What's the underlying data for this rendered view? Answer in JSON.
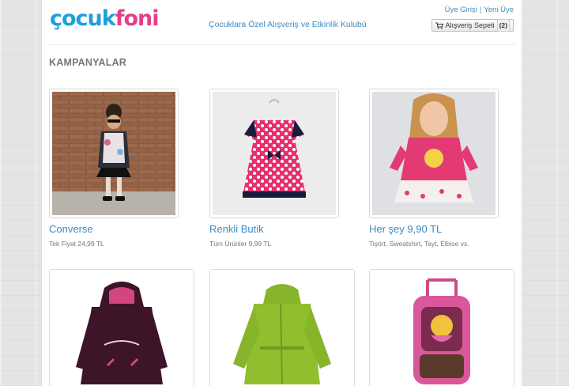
{
  "brand": {
    "logo_part1": "çocuk",
    "logo_part2": "foni",
    "tagline": "Çocuklara Özel Alışveriş ve Etkinlik Kulubü"
  },
  "user_links": {
    "login": "Üye Girişi",
    "separator": "|",
    "register": "Yeni Üye"
  },
  "cart": {
    "label": "Alışveriş Sepeti",
    "count": "2"
  },
  "section_title": "KAMPANYALAR",
  "campaigns": [
    {
      "title": "Converse",
      "subtitle": "Tek Fiyat 24,99 TL"
    },
    {
      "title": "Renkli Butik",
      "subtitle": "Tüm Ürünler 9,99 TL"
    },
    {
      "title": "Her şey 9,90 TL",
      "subtitle": "Tişört, Sweatshirt, Tayt, Elbise vs."
    }
  ],
  "colors": {
    "link": "#3a8cc4",
    "logo_blue": "#1fa0d8",
    "logo_pink": "#e43f8a"
  }
}
